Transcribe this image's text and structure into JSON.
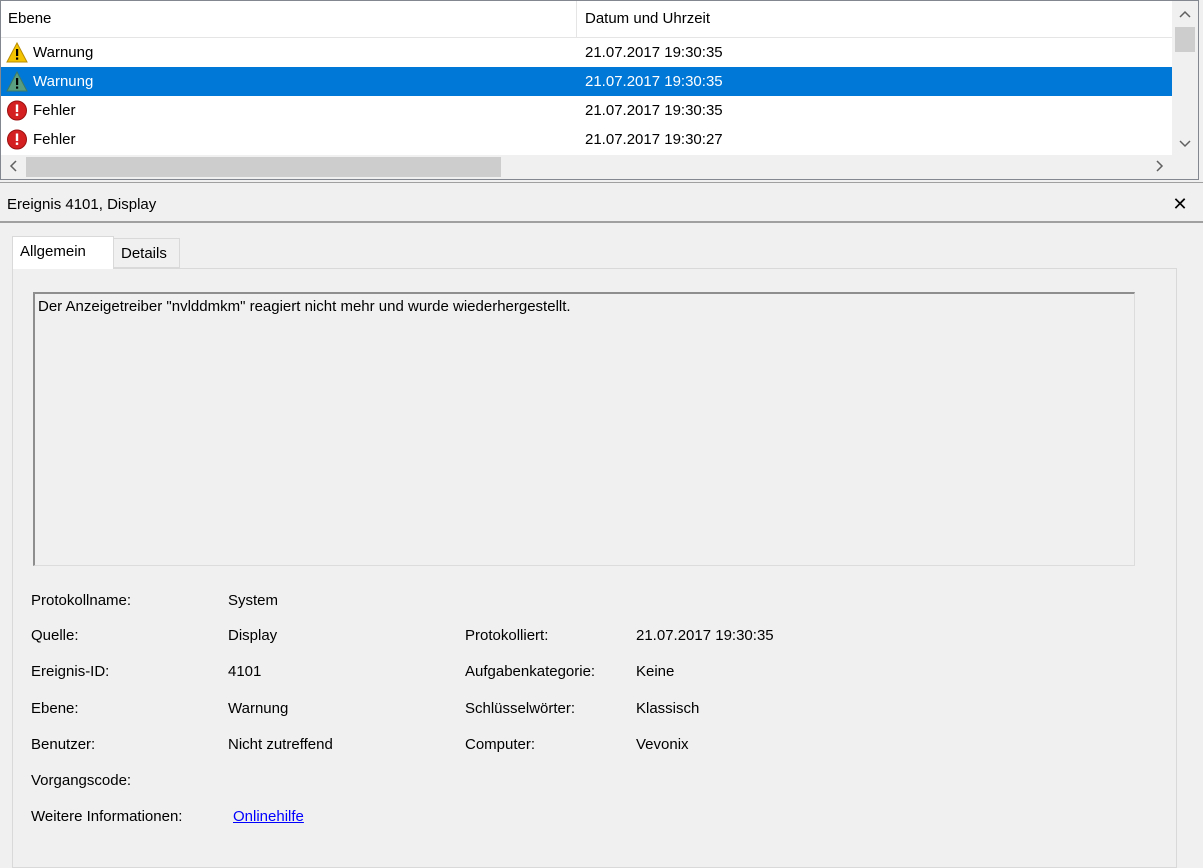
{
  "list": {
    "columns": {
      "level": "Ebene",
      "datetime": "Datum und Uhrzeit"
    },
    "rows": [
      {
        "level": "Warnung",
        "datetime": "21.07.2017 19:30:35",
        "icon": "warning-icon",
        "selected": false
      },
      {
        "level": "Warnung",
        "datetime": "21.07.2017 19:30:35",
        "icon": "warning-icon",
        "selected": true
      },
      {
        "level": "Fehler",
        "datetime": "21.07.2017 19:30:35",
        "icon": "error-icon",
        "selected": false
      },
      {
        "level": "Fehler",
        "datetime": "21.07.2017 19:30:27",
        "icon": "error-icon",
        "selected": false
      }
    ],
    "scroll_arrows": {
      "up": "^",
      "down": "⌄",
      "left": "<",
      "right": ">"
    }
  },
  "detail": {
    "title": "Ereignis 4101, Display",
    "close_glyph": "✕",
    "tabs": [
      "Allgemein",
      "Details"
    ],
    "message": "Der Anzeigetreiber \"nvlddmkm\" reagiert nicht mehr und wurde wiederhergestellt.",
    "fields": {
      "log_name_label": "Protokollname:",
      "log_name": "System",
      "source_label": "Quelle:",
      "source": "Display",
      "logged_label": "Protokolliert:",
      "logged": "21.07.2017 19:30:35",
      "event_id_label": "Ereignis-ID:",
      "event_id": "4101",
      "task_label": "Aufgabenkategorie:",
      "task": "Keine",
      "level_label": "Ebene:",
      "level": "Warnung",
      "keywords_label": "Schlüsselwörter:",
      "keywords": "Klassisch",
      "user_label": "Benutzer:",
      "user": "Nicht zutreffend",
      "computer_label": "Computer:",
      "computer": "Vevonix",
      "opcode_label": "Vorgangscode:",
      "more_info_label": "Weitere Informationen:",
      "more_info_link": "Onlinehilfe"
    }
  },
  "colors": {
    "selection": "#0078d7",
    "link": "#0000ff"
  }
}
